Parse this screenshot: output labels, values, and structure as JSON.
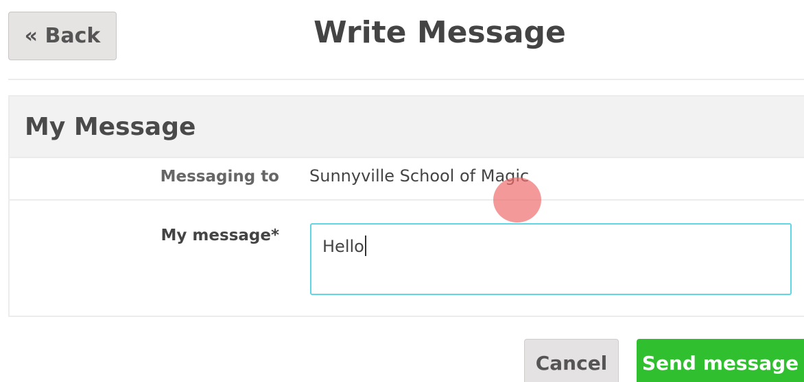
{
  "header": {
    "back_label": "« Back",
    "title": "Write Message"
  },
  "panel": {
    "heading": "My Message",
    "to_label": "Messaging to",
    "to_value": "Sunnyville School of Magic",
    "message_label": "My message*",
    "message_value": "Hello"
  },
  "actions": {
    "cancel_label": "Cancel",
    "send_label": "Send message"
  },
  "colors": {
    "send_button": "#2fbf2f",
    "input_focus_border": "#5ed6e6",
    "touch_indicator": "#f06e6e"
  }
}
